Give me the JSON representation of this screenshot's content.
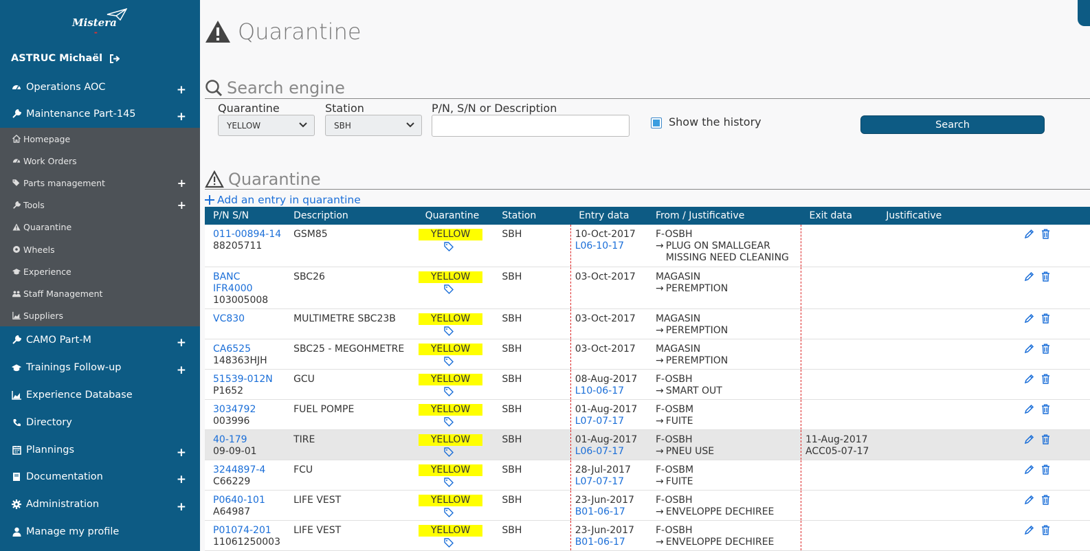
{
  "sidebar": {
    "logo_text": "Mistera",
    "user_name": "ASTRUC Michaël",
    "menu": [
      {
        "label": "Operations AOC",
        "icon": "gauge-icon",
        "expandable": true
      },
      {
        "label": "Maintenance Part-145",
        "icon": "wrench-icon",
        "expandable": true
      },
      {
        "label": "CAMO Part-M",
        "icon": "wrench-icon",
        "expandable": true
      },
      {
        "label": "Trainings Follow-up",
        "icon": "graduation-cap-icon",
        "expandable": true
      },
      {
        "label": "Experience Database",
        "icon": "area-chart-icon",
        "expandable": false
      },
      {
        "label": "Directory",
        "icon": "phone-icon",
        "expandable": false
      },
      {
        "label": "Plannings",
        "icon": "calendar-icon",
        "expandable": true
      },
      {
        "label": "Documentation",
        "icon": "book-icon",
        "expandable": true
      },
      {
        "label": "Administration",
        "icon": "gear-icon",
        "expandable": true
      },
      {
        "label": "Manage my profile",
        "icon": "user-icon",
        "expandable": false
      }
    ],
    "submenu": [
      {
        "label": "Homepage",
        "icon": "home-icon",
        "expandable": false
      },
      {
        "label": "Work Orders",
        "icon": "gauge-icon",
        "expandable": false
      },
      {
        "label": "Parts management",
        "icon": "tags-icon",
        "expandable": true
      },
      {
        "label": "Tools",
        "icon": "wrench-icon",
        "expandable": true
      },
      {
        "label": "Quarantine",
        "icon": "warning-icon",
        "expandable": false
      },
      {
        "label": "Wheels",
        "icon": "circle-icon",
        "expandable": false
      },
      {
        "label": "Experience",
        "icon": "graduation-cap-icon",
        "expandable": false
      },
      {
        "label": "Staff Management",
        "icon": "users-icon",
        "expandable": false
      },
      {
        "label": "Suppliers",
        "icon": "area-chart-icon",
        "expandable": false
      }
    ]
  },
  "page": {
    "title": "Quarantine",
    "search_title": "Search engine",
    "filters": {
      "quarantine_label": "Quarantine",
      "quarantine_value": "YELLOW",
      "station_label": "Station",
      "station_value": "SBH",
      "pn_label": "P/N, S/N or Description",
      "pn_value": "",
      "history_label": "Show the history",
      "history_checked": true,
      "search_button": "Search"
    },
    "list_title": "Quarantine",
    "add_link": "Add an entry in quarantine"
  },
  "table": {
    "headers": [
      "P/N S/N",
      "Description",
      "Quarantine",
      "Station",
      "Entry data",
      "From / Justificative",
      "Exit data",
      "Justificative"
    ],
    "rows": [
      {
        "pn": [
          "011-00894-14"
        ],
        "sn": "88205711",
        "desc": "GSM85",
        "quarantine": "YELLOW",
        "station": "SBH",
        "entry_date": "10-Oct-2017",
        "entry_ref": "L06-10-17",
        "from": "F-OSBH",
        "just": "PLUG ON SMALLGEAR MISSING NEED CLEANING",
        "exit_date": "",
        "exit_ref": "",
        "highlight": false
      },
      {
        "pn": [
          "BANC",
          "IFR4000"
        ],
        "sn": "103005008",
        "desc": "SBC26",
        "quarantine": "YELLOW",
        "station": "SBH",
        "entry_date": "03-Oct-2017",
        "entry_ref": "",
        "from": "MAGASIN",
        "just": "PEREMPTION",
        "exit_date": "",
        "exit_ref": "",
        "highlight": false
      },
      {
        "pn": [
          "VC830"
        ],
        "sn": "",
        "desc": "MULTIMETRE SBC23B",
        "quarantine": "YELLOW",
        "station": "SBH",
        "entry_date": "03-Oct-2017",
        "entry_ref": "",
        "from": "MAGASIN",
        "just": "PEREMPTION",
        "exit_date": "",
        "exit_ref": "",
        "highlight": false
      },
      {
        "pn": [
          "CA6525"
        ],
        "sn": "148363HJH",
        "desc": "SBC25 - MEGOHMETRE",
        "quarantine": "YELLOW",
        "station": "SBH",
        "entry_date": "03-Oct-2017",
        "entry_ref": "",
        "from": "MAGASIN",
        "just": "PEREMPTION",
        "exit_date": "",
        "exit_ref": "",
        "highlight": false
      },
      {
        "pn": [
          "51539-012N"
        ],
        "sn": "P1652",
        "desc": "GCU",
        "quarantine": "YELLOW",
        "station": "SBH",
        "entry_date": "08-Aug-2017",
        "entry_ref": "L10-06-17",
        "from": "F-OSBH",
        "just": "SMART OUT",
        "exit_date": "",
        "exit_ref": "",
        "highlight": false
      },
      {
        "pn": [
          "3034792"
        ],
        "sn": "003996",
        "desc": "FUEL POMPE",
        "quarantine": "YELLOW",
        "station": "SBH",
        "entry_date": "01-Aug-2017",
        "entry_ref": "L07-07-17",
        "from": "F-OSBM",
        "just": "FUITE",
        "exit_date": "",
        "exit_ref": "",
        "highlight": false
      },
      {
        "pn": [
          "40-179"
        ],
        "sn": "09-09-01",
        "desc": "TIRE",
        "quarantine": "YELLOW",
        "station": "SBH",
        "entry_date": "01-Aug-2017",
        "entry_ref": "L06-07-17",
        "from": "F-OSBH",
        "just": "PNEU USE",
        "exit_date": "11-Aug-2017",
        "exit_ref": "ACC05-07-17",
        "highlight": true
      },
      {
        "pn": [
          "3244897-4"
        ],
        "sn": "C66229",
        "desc": "FCU",
        "quarantine": "YELLOW",
        "station": "SBH",
        "entry_date": "28-Jul-2017",
        "entry_ref": "L07-07-17",
        "from": "F-OSBM",
        "just": "FUITE",
        "exit_date": "",
        "exit_ref": "",
        "highlight": false
      },
      {
        "pn": [
          "P0640-101"
        ],
        "sn": "A64987",
        "desc": "LIFE VEST",
        "quarantine": "YELLOW",
        "station": "SBH",
        "entry_date": "23-Jun-2017",
        "entry_ref": "B01-06-17",
        "from": "F-OSBH",
        "just": "ENVELOPPE DECHIREE",
        "exit_date": "",
        "exit_ref": "",
        "highlight": false
      },
      {
        "pn": [
          "P01074-201"
        ],
        "sn": "11061250003",
        "desc": "LIFE VEST",
        "quarantine": "YELLOW",
        "station": "SBH",
        "entry_date": "23-Jun-2017",
        "entry_ref": "B01-06-17",
        "from": "F-OSBH",
        "just": "ENVELOPPE DECHIREE",
        "exit_date": "",
        "exit_ref": "",
        "highlight": false
      }
    ]
  },
  "colors": {
    "sidebar": "#0d5b84",
    "submenu": "#4d5257",
    "link": "#1a6ed8",
    "badge": "#ffff00",
    "divider": "#dd2222"
  }
}
